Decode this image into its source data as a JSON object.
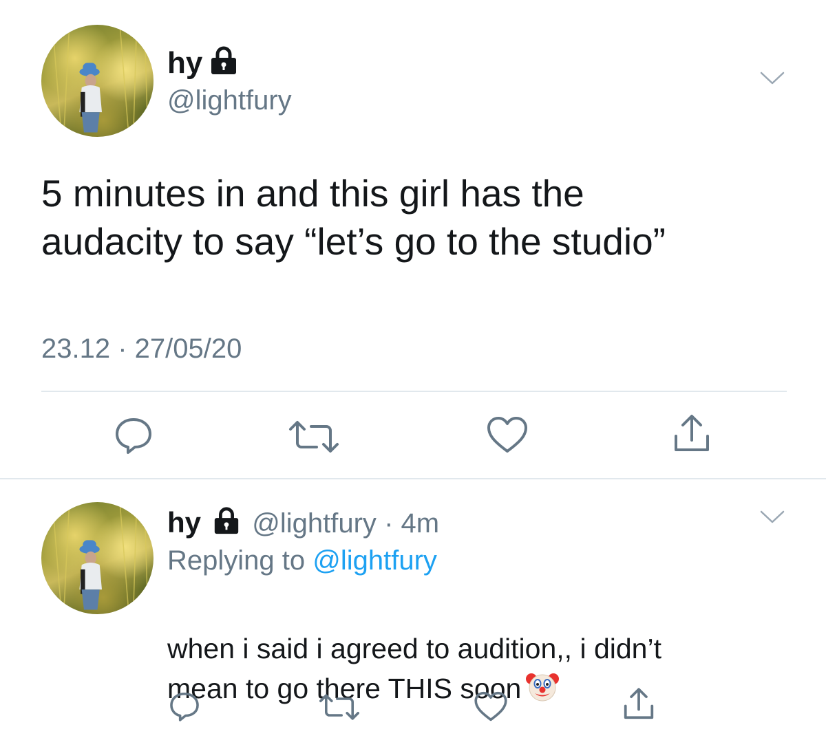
{
  "main_tweet": {
    "display_name": "hy",
    "handle": "@lightfury",
    "text": "5 minutes in and this girl has the\naudacity to say “let’s go to the studio”",
    "timestamp": "23.12 · 27/05/20",
    "icons": {
      "lock": "lock-icon",
      "chevron": "chevron-down-icon",
      "reply": "reply-icon",
      "retweet": "retweet-icon",
      "like": "heart-icon",
      "share": "share-icon"
    }
  },
  "reply_tweet": {
    "display_name": "hy",
    "handle": "@lightfury",
    "separator": "·",
    "time_ago": "4m",
    "replying_prefix": "Replying to",
    "replying_to": "@lightfury",
    "text": "when i said i agreed to audition,, i didn’t\nmean to go there THIS soon",
    "emoji": "clown-face-icon"
  },
  "colors": {
    "text": "#14171a",
    "secondary": "#657786",
    "link": "#1da1f2",
    "divider": "#e1e8ed"
  }
}
